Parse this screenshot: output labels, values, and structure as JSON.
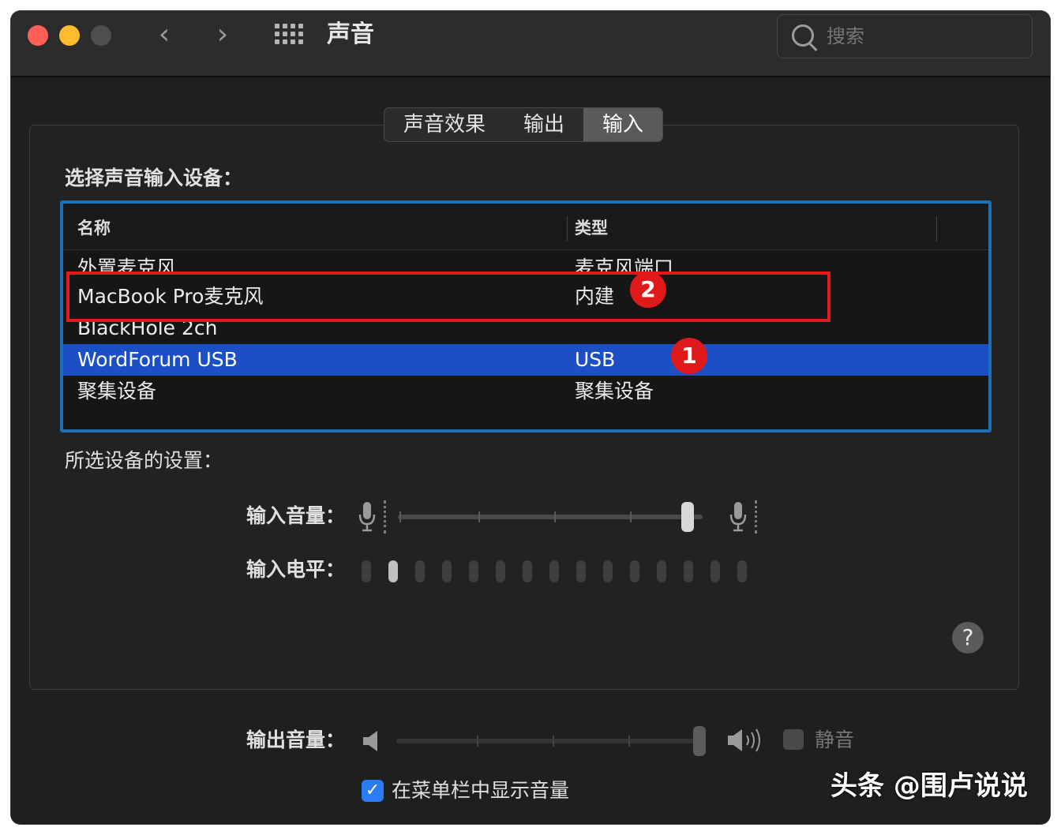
{
  "window": {
    "title": "声音"
  },
  "search": {
    "placeholder": "搜索"
  },
  "tabs": [
    {
      "label": "声音效果"
    },
    {
      "label": "输出"
    },
    {
      "label": "输入",
      "active": true
    }
  ],
  "input_section": {
    "title": "选择声音输入设备：",
    "columns": {
      "name": "名称",
      "type": "类型"
    },
    "devices": [
      {
        "name": "外置麦克风",
        "type": "麦克风端口"
      },
      {
        "name": "MacBook Pro麦克风",
        "type": "内建"
      },
      {
        "name": "BlackHole 2ch",
        "type": ""
      },
      {
        "name": "WordForum USB",
        "type": "USB",
        "selected": true
      },
      {
        "name": "聚集设备",
        "type": "聚集设备"
      }
    ]
  },
  "annotations": {
    "badge1": "1",
    "badge2": "2",
    "color": "#e0191b"
  },
  "settings": {
    "title": "所选设备的设置：",
    "input_volume_label": "输入音量：",
    "input_volume_level": 0.95,
    "input_level_label": "输入电平：",
    "input_level_active_bars": 2,
    "input_level_total_bars": 15
  },
  "help": {
    "label": "?"
  },
  "output": {
    "volume_label": "输出音量：",
    "volume_level": 0.99,
    "mute_label": "静音",
    "show_in_menubar_label": "在菜单栏中显示音量",
    "show_in_menubar_checked": true
  },
  "watermark": {
    "text": "头条 @围卢说说"
  },
  "colors": {
    "selection": "#1d4fc4",
    "table_border": "#1f6fb5",
    "checkbox": "#2a7cf6"
  }
}
